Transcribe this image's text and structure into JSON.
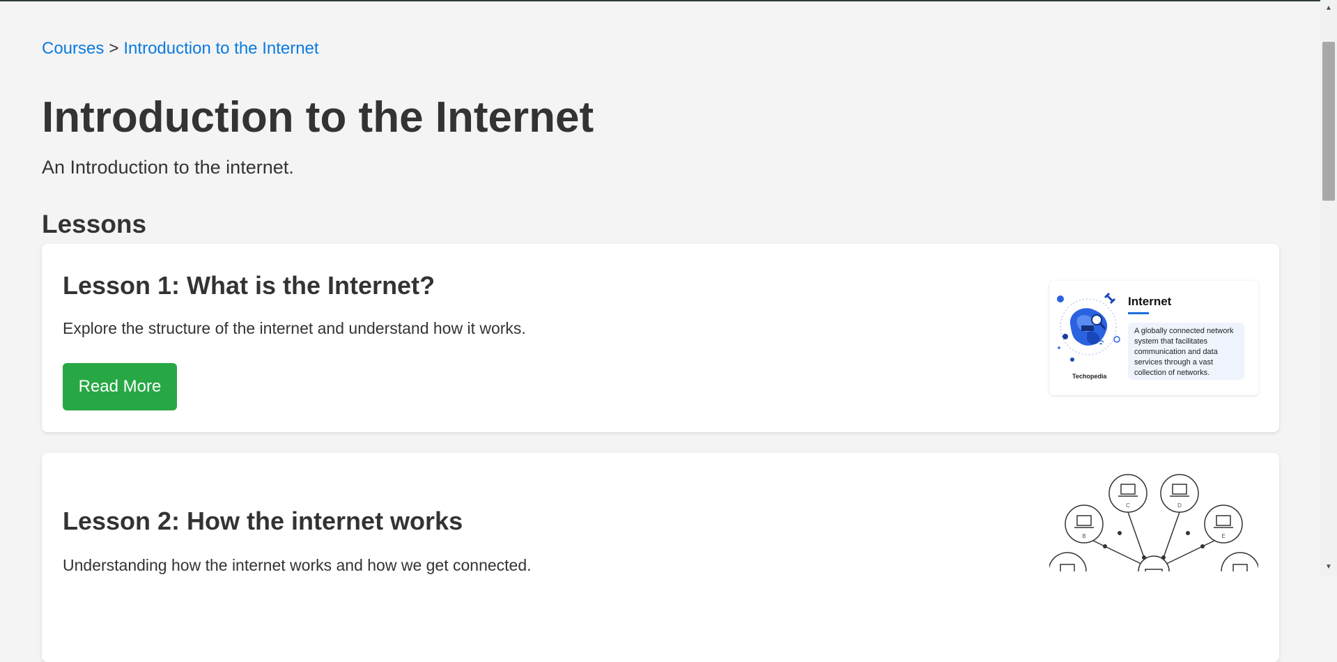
{
  "breadcrumb": {
    "root": "Courses",
    "separator": ">",
    "current": "Introduction to the Internet"
  },
  "course": {
    "title": "Introduction to the Internet",
    "description": "An Introduction to the internet."
  },
  "lessons_heading": "Lessons",
  "lessons": [
    {
      "title": "Lesson 1: What is the Internet?",
      "summary": "Explore the structure of the internet and understand how it works.",
      "button_label": "Read More",
      "thumbnail": {
        "title": "Internet",
        "text": "A globally connected network system that facilitates communication and data services through a vast collection of networks.",
        "brand": "Techopedia"
      }
    },
    {
      "title": "Lesson 2: How the internet works",
      "summary": "Understanding how the internet works and how we get connected.",
      "thumbnail": {
        "node_labels": [
          "B",
          "C",
          "D",
          "E"
        ]
      }
    }
  ],
  "colors": {
    "link": "#0a7be0",
    "button": "#28a745",
    "text": "#333333",
    "background": "#f4f4f4"
  },
  "icons": {
    "scroll_up": "scroll-up-arrow-icon",
    "scroll_down": "scroll-down-arrow-icon"
  }
}
